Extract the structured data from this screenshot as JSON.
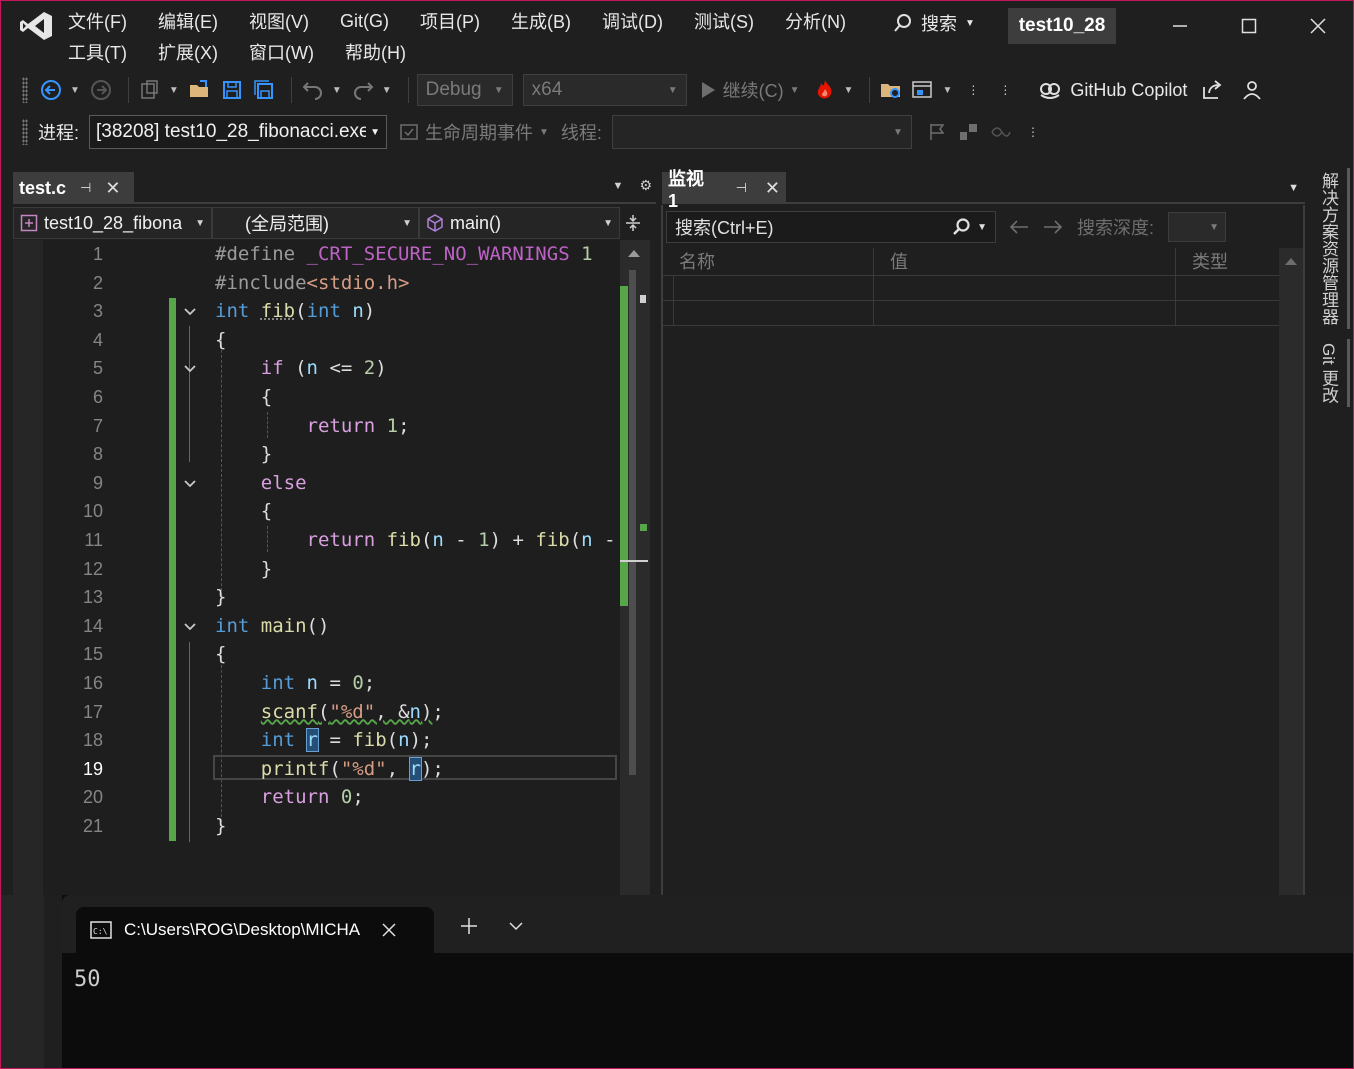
{
  "menu": {
    "row1": [
      "文件(F)",
      "编辑(E)",
      "视图(V)",
      "Git(G)",
      "项目(P)",
      "生成(B)",
      "调试(D)",
      "测试(S)",
      "分析(N)"
    ],
    "row2": [
      "工具(T)",
      "扩展(X)",
      "窗口(W)",
      "帮助(H)"
    ]
  },
  "title": {
    "search_label": "搜索",
    "solution_name": "test10_28"
  },
  "toolbar": {
    "config": "Debug",
    "platform": "x64",
    "continue_label": "继续(C)",
    "copilot_label": "GitHub Copilot"
  },
  "debug_location": {
    "process_label": "进程:",
    "process_value": "[38208] test10_28_fibonacci.exe",
    "lifecycle_label": "生命周期事件",
    "thread_label": "线程:"
  },
  "editor": {
    "tab_name": "test.c",
    "project_combo": "test10_28_fibona",
    "scope_combo": "(全局范围)",
    "member_combo": "main()",
    "current_line": 19,
    "line_numbers": [
      "1",
      "2",
      "3",
      "4",
      "5",
      "6",
      "7",
      "8",
      "9",
      "10",
      "11",
      "12",
      "13",
      "14",
      "15",
      "16",
      "17",
      "18",
      "19",
      "20",
      "21"
    ]
  },
  "watch": {
    "tab_name": "监视 1",
    "search_placeholder": "搜索(Ctrl+E)",
    "depth_label": "搜索深度:",
    "columns": [
      "名称",
      "值",
      "类型"
    ]
  },
  "side_tabs": [
    "解决方案资源管理器",
    "Git 更改"
  ],
  "terminal": {
    "tab_title": "C:\\Users\\ROG\\Desktop\\MICHA",
    "output": "50"
  },
  "colors": {
    "accent_border": "#c2185b",
    "change_bar": "#57a64a",
    "keyword": "#569cd6",
    "control": "#d8a0df",
    "function": "#dcdcaa"
  }
}
